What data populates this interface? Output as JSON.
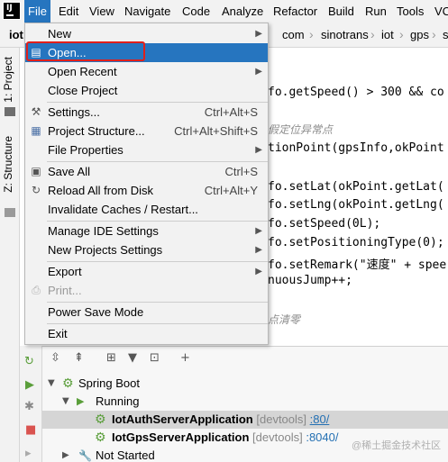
{
  "menubar": {
    "items": [
      {
        "label": "File",
        "active": true
      },
      {
        "label": "Edit"
      },
      {
        "label": "View"
      },
      {
        "label": "Navigate"
      },
      {
        "label": "Code"
      },
      {
        "label": "Analyze"
      },
      {
        "label": "Refactor"
      },
      {
        "label": "Build"
      },
      {
        "label": "Run"
      },
      {
        "label": "Tools"
      },
      {
        "label": "VC"
      }
    ]
  },
  "navbar": {
    "project": "iot",
    "crumbs": [
      "com",
      "sinotrans",
      "iot",
      "gps",
      "s"
    ]
  },
  "left_strip": {
    "project_tab": "1: Project",
    "structure_tab": "Z: Structure"
  },
  "file_menu": {
    "items": [
      {
        "label": "New",
        "submenu": true
      },
      {
        "label": "Open...",
        "highlighted": true
      },
      {
        "label": "Open Recent",
        "submenu": true
      },
      {
        "label": "Close Project"
      },
      {
        "label": "Settings...",
        "shortcut": "Ctrl+Alt+S",
        "icon": "wrench-icon"
      },
      {
        "label": "Project Structure...",
        "shortcut": "Ctrl+Alt+Shift+S",
        "icon": "project-structure-icon"
      },
      {
        "label": "File Properties",
        "submenu": true
      },
      {
        "label": "Save All",
        "shortcut": "Ctrl+S",
        "icon": "save-icon"
      },
      {
        "label": "Reload All from Disk",
        "shortcut": "Ctrl+Alt+Y",
        "icon": "reload-icon"
      },
      {
        "label": "Invalidate Caches / Restart..."
      },
      {
        "label": "Manage IDE Settings",
        "submenu": true
      },
      {
        "label": "New Projects Settings",
        "submenu": true
      },
      {
        "label": "Export",
        "submenu": true
      },
      {
        "label": "Print...",
        "disabled": true,
        "icon": "print-icon"
      },
      {
        "label": "Power Save Mode"
      },
      {
        "label": "Exit"
      }
    ]
  },
  "editor": {
    "lines": [
      "fo.getSpeed() > 300 && co",
      "假定位异常点",
      "tionPoint(gpsInfo,okPoint",
      "fo.setLat(okPoint.getLat(",
      "fo.setLng(okPoint.getLng(",
      "fo.setSpeed(0L);",
      "fo.setPositioningType(0);",
      "fo.setRemark(\"速度\" + spee",
      "nuousJump++;",
      "点清零"
    ]
  },
  "run_panel": {
    "tree": [
      {
        "label": "Spring Boot"
      },
      {
        "label": "Running"
      },
      {
        "label": "IotAuthServerApplication",
        "devtools": "[devtools]",
        "port": ":80/"
      },
      {
        "label": "IotGpsServerApplication",
        "devtools": "[devtools]",
        "port": ":8040/"
      },
      {
        "label": "Not Started"
      }
    ]
  },
  "watermark": "@稀土掘金技术社区",
  "colors": {
    "menu_highlight": "#2675bf",
    "annotation_box": "#e0201b",
    "run_green": "#5a9e3a"
  }
}
